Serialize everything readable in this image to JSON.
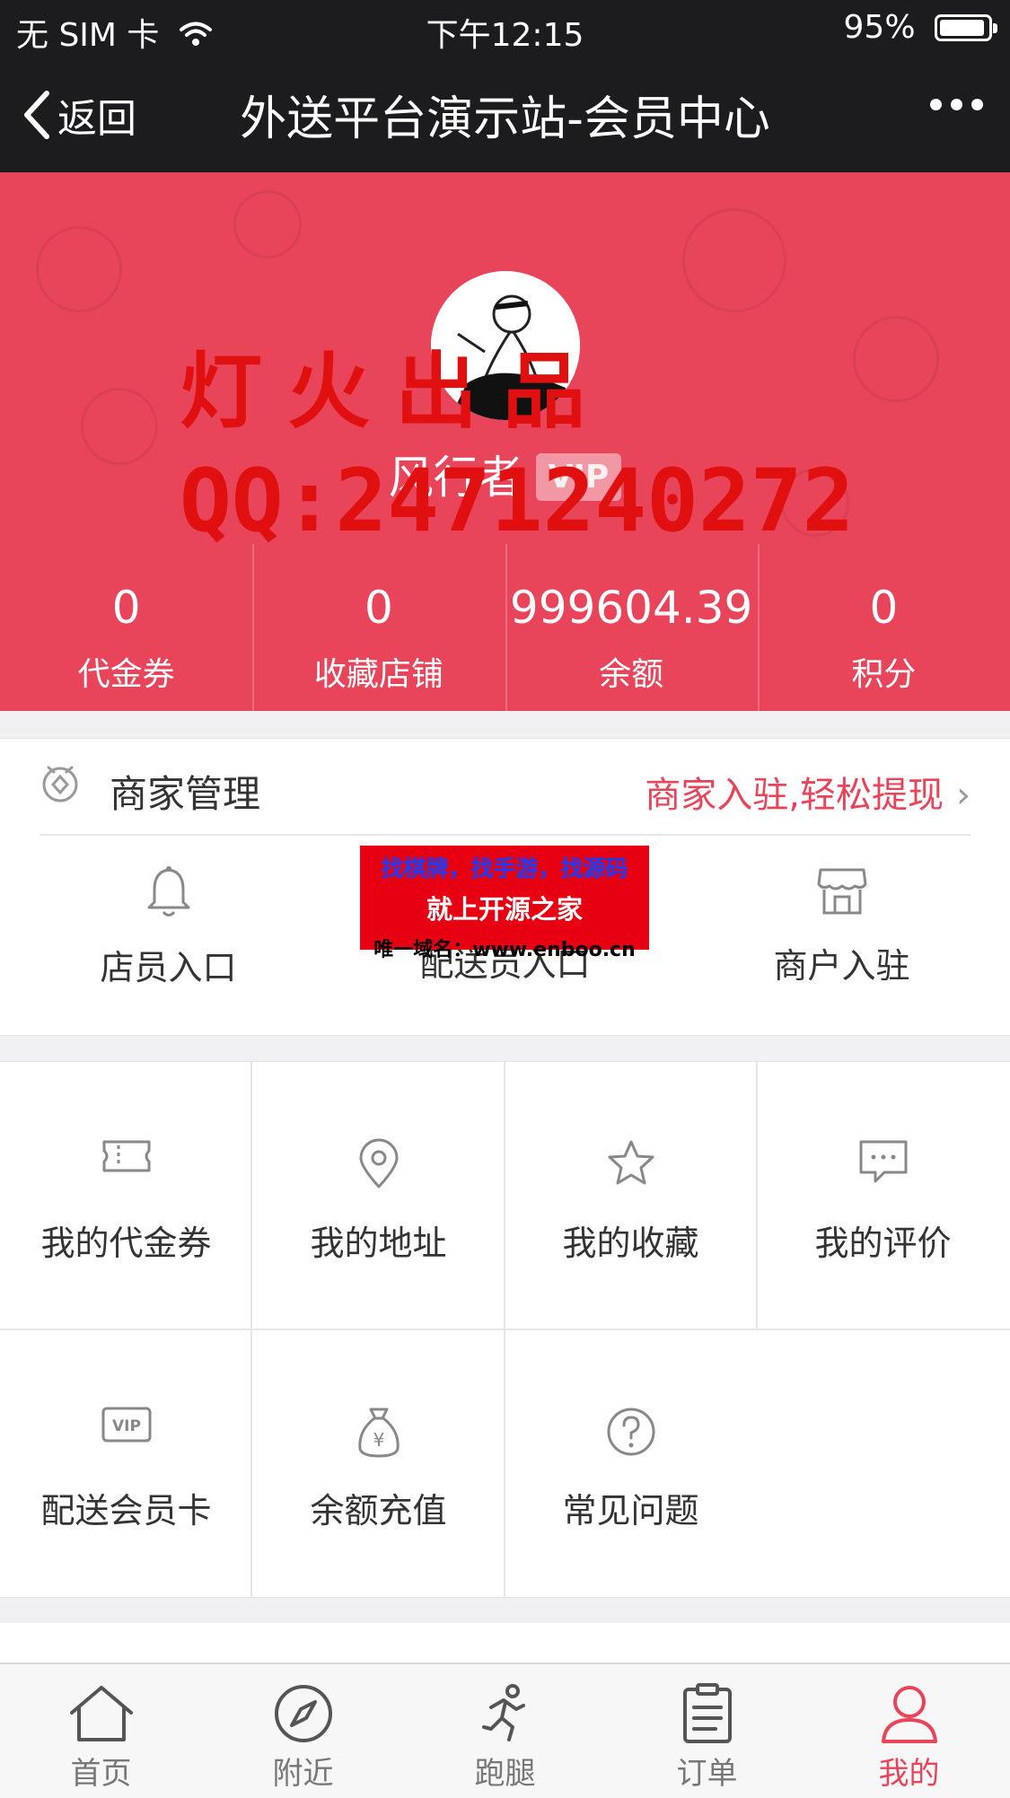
{
  "status_bar": {
    "carrier": "无 SIM 卡",
    "time": "下午12:15",
    "battery": "95%",
    "battery_level": 0.95
  },
  "nav": {
    "back_label": "返回",
    "title": "外送平台演示站-会员中心"
  },
  "profile": {
    "username": "风行者",
    "vip_badge": "VIP",
    "watermark_line1": "灯火出品",
    "watermark_line2": "QQ:2471240272"
  },
  "stats": [
    {
      "value": "0",
      "label": "代金券"
    },
    {
      "value": "0",
      "label": "收藏店铺"
    },
    {
      "value": "999604.39",
      "label": "余额"
    },
    {
      "value": "0",
      "label": "积分"
    }
  ],
  "merchant": {
    "title": "商家管理",
    "link": "商家入驻,轻松提现",
    "entries": [
      {
        "label": "店员入口"
      },
      {
        "label": "配送员入口"
      },
      {
        "label": "商户入驻"
      }
    ]
  },
  "ad": {
    "line1": "找棋牌，找手游，找源码",
    "line2": "就上开源之家",
    "line3": "唯一域名：www.enboo.cn"
  },
  "grid": {
    "items": [
      {
        "label": "我的代金券",
        "icon": "ticket-icon"
      },
      {
        "label": "我的地址",
        "icon": "location-pin-icon"
      },
      {
        "label": "我的收藏",
        "icon": "star-icon"
      },
      {
        "label": "我的评价",
        "icon": "comment-icon"
      },
      {
        "label": "配送会员卡",
        "icon": "vip-card-icon"
      },
      {
        "label": "余额充值",
        "icon": "money-bag-icon"
      },
      {
        "label": "常见问题",
        "icon": "question-icon"
      }
    ]
  },
  "tabbar": {
    "items": [
      {
        "label": "首页",
        "icon": "home-icon"
      },
      {
        "label": "附近",
        "icon": "compass-icon"
      },
      {
        "label": "跑腿",
        "icon": "runner-icon"
      },
      {
        "label": "订单",
        "icon": "order-list-icon"
      },
      {
        "label": "我的",
        "icon": "user-icon"
      }
    ],
    "active": "我的"
  },
  "colors": {
    "accent": "#e8445a",
    "nav_bg": "#1c1c1e",
    "watermark": "#e01010"
  }
}
